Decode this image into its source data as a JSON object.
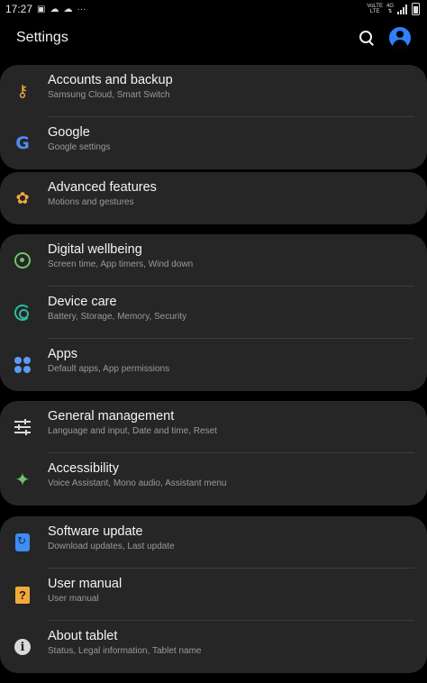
{
  "status_bar": {
    "time": "17:27",
    "left_icons": [
      "image-icon",
      "cloud-sync-icon",
      "cloud-sync-icon",
      "more-dots-icon"
    ],
    "network": {
      "volte": "VoLTE",
      "lte": "LTE",
      "gen": "4G"
    }
  },
  "app_bar": {
    "title": "Settings"
  },
  "colors": {
    "background": "#000000",
    "card": "#262626",
    "accent_blue": "#2f80ff",
    "orange": "#f2a93b",
    "green": "#6ec36a",
    "teal": "#2fb89e"
  },
  "groups": [
    {
      "items": [
        {
          "title": "Accounts and backup",
          "subtitle": "Samsung Cloud, Smart Switch",
          "icon": "key-icon"
        },
        {
          "title": "Google",
          "subtitle": "Google settings",
          "icon": "google-icon"
        }
      ]
    },
    {
      "items": [
        {
          "title": "Advanced features",
          "subtitle": "Motions and gestures",
          "icon": "gear-plus-icon"
        }
      ]
    },
    {
      "items": [
        {
          "title": "Digital wellbeing",
          "subtitle": "Screen time, App timers, Wind down",
          "icon": "wellbeing-icon"
        },
        {
          "title": "Device care",
          "subtitle": "Battery, Storage, Memory, Security",
          "icon": "device-care-icon"
        },
        {
          "title": "Apps",
          "subtitle": "Default apps, App permissions",
          "icon": "apps-grid-icon"
        }
      ]
    },
    {
      "items": [
        {
          "title": "General management",
          "subtitle": "Language and input, Date and time, Reset",
          "icon": "sliders-icon"
        },
        {
          "title": "Accessibility",
          "subtitle": "Voice Assistant, Mono audio, Assistant menu",
          "icon": "accessibility-icon"
        }
      ]
    },
    {
      "items": [
        {
          "title": "Software update",
          "subtitle": "Download updates, Last update",
          "icon": "software-update-icon"
        },
        {
          "title": "User manual",
          "subtitle": "User manual",
          "icon": "user-manual-icon"
        },
        {
          "title": "About tablet",
          "subtitle": "Status, Legal information, Tablet name",
          "icon": "info-icon"
        }
      ]
    }
  ]
}
